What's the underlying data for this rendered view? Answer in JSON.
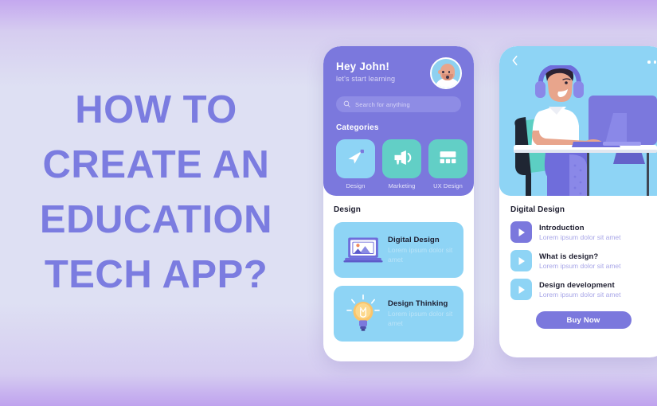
{
  "headline": {
    "lines": [
      "HOW TO",
      "CREATE AN",
      "EDUCATION",
      "TECH APP?"
    ],
    "color": "#7b7ce0"
  },
  "phone1": {
    "greeting": "Hey John!",
    "subtitle": "let's start learning",
    "avatar_name": "user-avatar",
    "search": {
      "placeholder": "Search for anything",
      "value": "Search for anything"
    },
    "categories_label": "Categories",
    "categories": [
      {
        "name": "Design",
        "icon": "paper-plane-icon",
        "color": "#8ed4f5"
      },
      {
        "name": "Marketing",
        "icon": "megaphone-icon",
        "color": "#62cfc6"
      },
      {
        "name": "UX Design",
        "icon": "layout-grid-icon",
        "color": "#62cfc6"
      }
    ],
    "section_title": "Design",
    "courses": [
      {
        "title": "Digital Design",
        "desc": "Lorem ipsum dolor sit amet",
        "icon": "laptop-image-icon",
        "bg": "#8ed4f5"
      },
      {
        "title": "Design Thinking",
        "desc": "Lorem ipsum dolor sit amet",
        "icon": "lightbulb-icon",
        "bg": "#8ed4f5"
      }
    ]
  },
  "phone2": {
    "back_icon": "chevron-left-icon",
    "menu_icon": "more-dots-icon",
    "hero_icon": "student-at-desk-illustration",
    "section_title": "Digital Design",
    "lessons": [
      {
        "title": "Introduction",
        "desc": "Lorem ipsum dolor sit amet",
        "color": "#7b78dd"
      },
      {
        "title": "What is design?",
        "desc": "Lorem ipsum dolor sit amet",
        "color": "#8ed4f5"
      },
      {
        "title": "Design development",
        "desc": "Lorem ipsum dolor sit amet",
        "color": "#8ed4f5"
      }
    ],
    "buy_label": "Buy Now"
  },
  "theme": {
    "purple": "#7b78dd",
    "light_blue": "#8ed4f5",
    "teal": "#62cfc6",
    "bg_top": "#c4a8ef",
    "bg_mid": "#dee0f3"
  }
}
